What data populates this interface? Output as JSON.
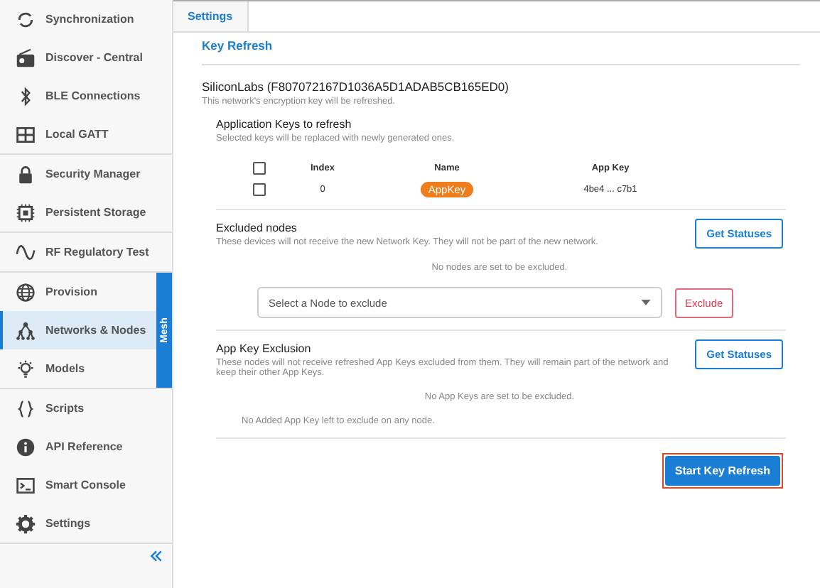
{
  "sidebar": {
    "groups": [
      {
        "items": [
          {
            "label": "Synchronization",
            "selected": false
          },
          {
            "label": "Discover - Central",
            "selected": false
          },
          {
            "label": "BLE Connections",
            "selected": false
          },
          {
            "label": "Local GATT",
            "selected": false
          }
        ]
      },
      {
        "items": [
          {
            "label": "Security Manager",
            "selected": false
          },
          {
            "label": "Persistent Storage",
            "selected": false
          }
        ]
      },
      {
        "items": [
          {
            "label": "RF Regulatory Test",
            "selected": false
          }
        ]
      },
      {
        "tab_label": "Mesh",
        "items": [
          {
            "label": "Provision",
            "selected": false
          },
          {
            "label": "Networks & Nodes",
            "selected": true
          },
          {
            "label": "Models",
            "selected": false
          }
        ]
      },
      {
        "items": [
          {
            "label": "Scripts",
            "selected": false
          },
          {
            "label": "API Reference",
            "selected": false
          },
          {
            "label": "Smart Console",
            "selected": false
          },
          {
            "label": "Settings",
            "selected": false
          }
        ]
      }
    ]
  },
  "tabs": [
    {
      "label": "Settings",
      "selected": true
    }
  ],
  "section_title": "Key Refresh",
  "network": {
    "name": "SiliconLabs (F807072167D1036A5D1ADAB5CB165ED0)",
    "note": "This network's encryption key will be refreshed."
  },
  "app_keys": {
    "title": "Application Keys to refresh",
    "hint": "Selected keys will be replaced with newly generated ones.",
    "all_checked": false,
    "columns": [
      "Index",
      "Name",
      "App Key"
    ],
    "rows": [
      {
        "checked": false,
        "index": "0",
        "name": "AppKey",
        "app_key": "4be4 ... c7b1"
      }
    ]
  },
  "excluded_nodes": {
    "title": "Excluded nodes",
    "hint": "These devices will not receive the new Network Key. They will not be part of the new network.",
    "button": "Get Statuses",
    "empty": "No nodes are set to be excluded.",
    "select_placeholder": "Select a Node to exclude",
    "exclude_button": "Exclude"
  },
  "app_key_exclusion": {
    "title": "App Key Exclusion",
    "hint": "These nodes will not receive refreshed App Keys excluded from them. They will remain part of the network and keep their other App Keys.",
    "button": "Get Statuses",
    "empty": "No App Keys are set to be excluded.",
    "note": "No Added App Key left to exclude on any node."
  },
  "start_button": {
    "label": "Start Key Refresh",
    "highlighted": true
  }
}
